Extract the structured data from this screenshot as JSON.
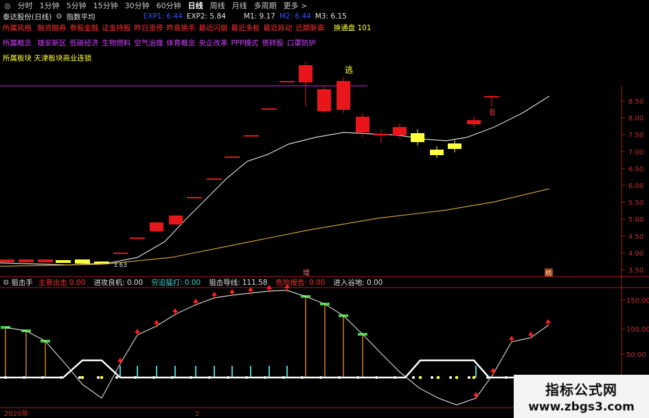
{
  "timeframe_bar": {
    "items": [
      "分时",
      "1分钟",
      "5分钟",
      "15分钟",
      "30分钟",
      "60分钟",
      "日线",
      "周线",
      "月线",
      "多周期",
      "更多 >"
    ],
    "active": "日线"
  },
  "header": {
    "stock_name": "泰达股份(日线)",
    "indicator_name": "指数平均",
    "exp1": "EXP1: 6.44",
    "exp2": "EXP2: 5.84",
    "m1": "M1: 9.17",
    "m2": "M2: 6.44",
    "m3": "M3: 6.15"
  },
  "concept_rows": {
    "style": {
      "label": "所属风格",
      "tags": [
        "融资融券",
        "参股金融",
        "证金持股",
        "昨日涨停",
        "昨高换手",
        "最近闪崩",
        "最近多板",
        "最近异动",
        "近期新高"
      ],
      "tail": "换通盘 101"
    },
    "concept": {
      "label": "所属概念",
      "tags": [
        "雄安新区",
        "低碳经济",
        "生物燃料",
        "空气治理",
        "体育概念",
        "央企改革",
        "PPP模式",
        "债转股",
        "口罩防护"
      ]
    },
    "sector": {
      "label": "所属板块",
      "value": "天津板块商业连锁"
    }
  },
  "price_axis": {
    "labels": [
      "8.50",
      "8.00",
      "7.50",
      "7.00",
      "6.50",
      "6.00",
      "5.50",
      "5.00",
      "4.50",
      "4.00",
      "3.50"
    ]
  },
  "main_chart_labels": {
    "escape": "逃",
    "buy": "B",
    "zeng": "增",
    "price_note": "3.63",
    "bottom_tag": "柄"
  },
  "sub_indicator": {
    "name": "狙击手",
    "items": [
      {
        "label": "主意出击",
        "value": "0.00",
        "color": "#ff3030"
      },
      {
        "label": "进攻良机:",
        "value": "0.00",
        "color": "#e0e0e0"
      },
      {
        "label": "穷追猛打:",
        "value": "0.00",
        "color": "#40d0d0"
      },
      {
        "label": "狙击导线:",
        "value": "111.58",
        "color": "#e0e0e0"
      },
      {
        "label": "危险报告:",
        "value": "0.00",
        "color": "#ff3030"
      },
      {
        "label": "进入谷地:",
        "value": "0.00",
        "color": "#e0e0e0"
      }
    ],
    "axis_labels": [
      "150.00",
      "100.00",
      "50.00"
    ]
  },
  "bottom_axis": {
    "year": "2020年",
    "month": "2"
  },
  "watermark": {
    "line1": "指标公式网",
    "line2": "www.zbgs3.com"
  },
  "colors": {
    "up": "#e8161a",
    "down_yellow": "#ffff40",
    "red_axis": "#c83030",
    "ma_white": "#d8d8d8",
    "ma_gold": "#c8a030",
    "purple_line": "#a020c0"
  }
}
